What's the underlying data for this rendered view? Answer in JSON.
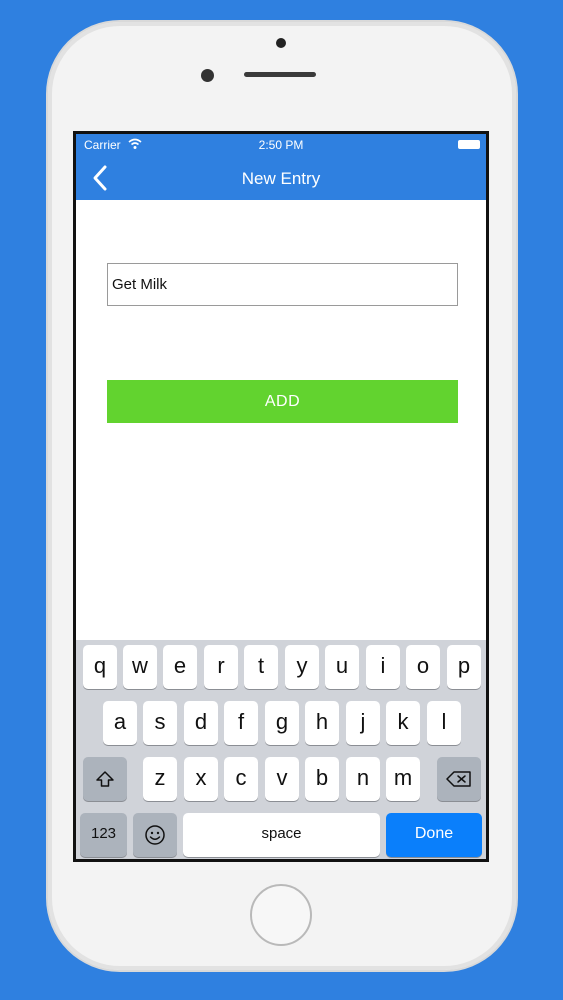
{
  "status_bar": {
    "carrier": "Carrier",
    "time": "2:50 PM",
    "wifi_icon": "wifi-icon",
    "battery_icon": "battery-icon"
  },
  "nav": {
    "title": "New Entry",
    "back_icon": "chevron-left-icon"
  },
  "form": {
    "entry_value": "Get Milk",
    "add_label": "ADD"
  },
  "keyboard": {
    "row1": [
      "q",
      "w",
      "e",
      "r",
      "t",
      "y",
      "u",
      "i",
      "o",
      "p"
    ],
    "row2": [
      "a",
      "s",
      "d",
      "f",
      "g",
      "h",
      "j",
      "k",
      "l"
    ],
    "row3": [
      "z",
      "x",
      "c",
      "v",
      "b",
      "n",
      "m"
    ],
    "numbers_label": "123",
    "space_label": "space",
    "done_label": "Done",
    "shift_icon": "shift-icon",
    "backspace_icon": "backspace-icon",
    "emoji_icon": "emoji-icon"
  },
  "colors": {
    "nav_blue": "#2f80e0",
    "add_green": "#62d32f",
    "done_blue": "#0a7ffb",
    "keyboard_bg": "#d0d3d9"
  }
}
